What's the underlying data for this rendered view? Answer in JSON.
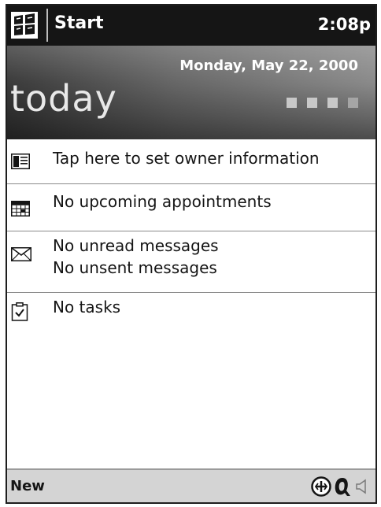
{
  "titlebar": {
    "start_icon": "start-menu-flag-icon",
    "start_label": "Start",
    "time": "2:08p"
  },
  "banner": {
    "date": "Monday, May 22, 2000",
    "today": "today"
  },
  "items": {
    "owner": {
      "text": "Tap here to set owner information",
      "icon": "owner-card-icon"
    },
    "calendar": {
      "text": "No upcoming appointments",
      "icon": "calendar-icon"
    },
    "inbox": {
      "line1": "No unread messages",
      "line2": "No unsent messages",
      "icon": "envelope-icon"
    },
    "tasks": {
      "text": "No tasks",
      "icon": "tasks-clipboard-icon"
    }
  },
  "cmdbar": {
    "new_label": "New",
    "tray_icons": [
      "connectivity-icon",
      "input-method-icon",
      "speaker-icon"
    ]
  },
  "colors": {
    "titlebar_bg": "#151515",
    "banner_dark": "#3a3a3a",
    "banner_light": "#8a8a8a",
    "cmdbar_bg": "#d4d4d4"
  }
}
